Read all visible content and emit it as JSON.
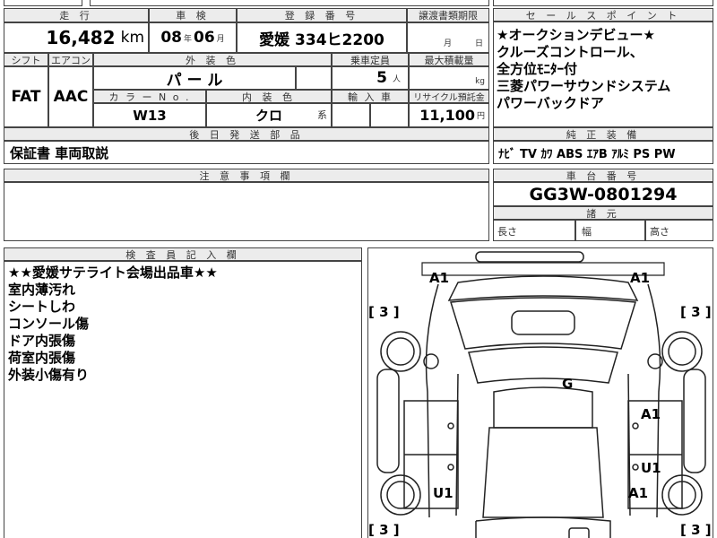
{
  "mileage": {
    "label": "走 行",
    "value": "16,482",
    "unit": "km"
  },
  "inspection": {
    "label": "車 検",
    "year": "08",
    "year_unit": "年",
    "month": "06",
    "month_unit": "月"
  },
  "registration": {
    "label": "登 録 番 号",
    "value": "愛媛 334ヒ2200"
  },
  "transfer_deadline": {
    "label": "譲渡書類期限",
    "month_unit": "月",
    "day_unit": "日"
  },
  "shift": {
    "label": "シフト",
    "value": "FAT"
  },
  "aircon": {
    "label": "エアコン",
    "value": "AAC"
  },
  "exterior_color": {
    "label": "外 装 色",
    "value": "パ ー ル"
  },
  "capacity": {
    "label": "乗車定員",
    "value": "5",
    "unit": "人"
  },
  "max_load": {
    "label": "最大積載量",
    "unit": "kg"
  },
  "color_no": {
    "label": "カ ラ ー N o .",
    "value": "W13"
  },
  "interior_color": {
    "label": "内 装 色",
    "value": "クロ",
    "suffix": "系"
  },
  "import": {
    "label": "輸 入 車"
  },
  "recycle": {
    "label": "リサイクル預託金",
    "value": "11,100",
    "unit": "円"
  },
  "later_parts": {
    "label": "後 日 発 送 部 品",
    "value": "保証書 車両取説"
  },
  "notes": {
    "label": "注 意 事 項 欄"
  },
  "inspector": {
    "label": "検 査 員 記 入 欄",
    "lines": [
      "★★愛媛サテライト会場出品車★★",
      "室内薄汚れ",
      "シートしわ",
      "コンソール傷",
      "ドア内張傷",
      "荷室内張傷",
      "外装小傷有り"
    ]
  },
  "sales_points": {
    "label": "セ ー ル ス ポ イ ン ト",
    "lines": [
      "★オークションデビュー★",
      "クルーズコントロール、",
      "全方位ﾓﾆﾀｰ付",
      "三菱パワーサウンドシステム",
      "パワーバックドア"
    ]
  },
  "equipment": {
    "label": "純 正 装 備",
    "value": "ﾅﾋﾞ TV ｶﾜ ABS ｴｱB ｱﾙﾐ PS PW"
  },
  "chassis": {
    "label": "車 台 番 号",
    "value": "GG3W-0801294"
  },
  "dimensions": {
    "label": "諸 元",
    "length": "長さ",
    "width": "幅",
    "height": "高さ"
  },
  "diagram": {
    "marks": {
      "a1_front_left": "A1",
      "a1_front_right": "A1",
      "g_roof": "G",
      "a1_right_rear_door": "A1",
      "u1_right_rear": "U1",
      "u1_left_rear": "U1",
      "a1_right_quarter": "A1"
    },
    "tires": {
      "front_left": "3",
      "front_right": "3",
      "rear_left": "3",
      "rear_right": "3"
    }
  }
}
